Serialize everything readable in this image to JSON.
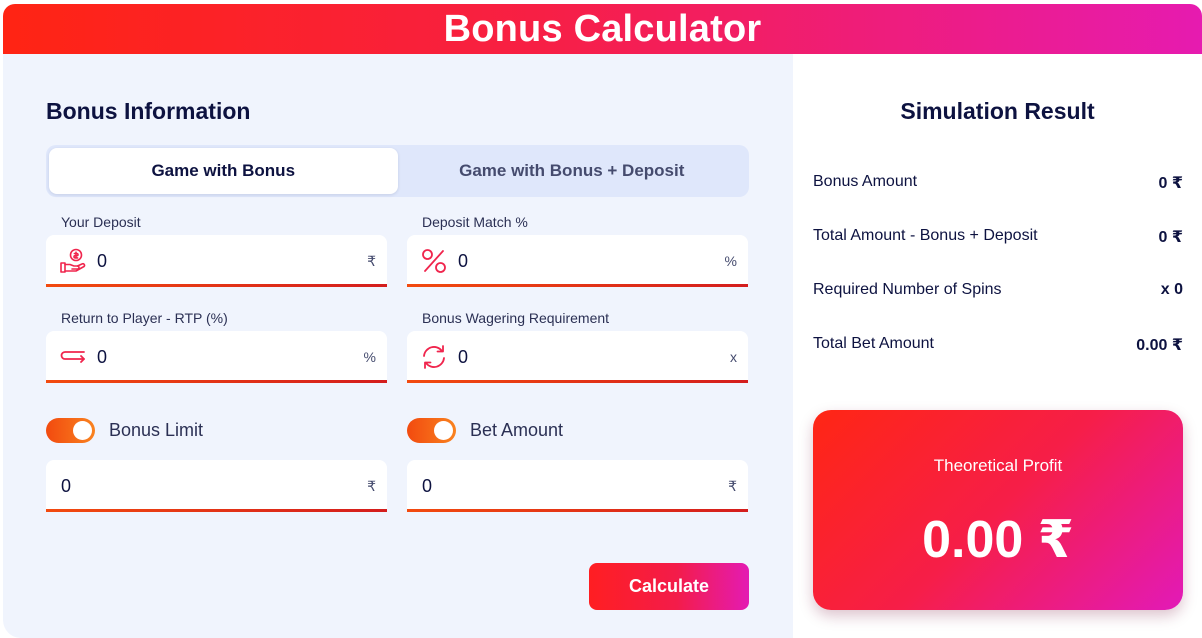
{
  "header": {
    "title": "Bonus Calculator"
  },
  "bonus_info": {
    "title": "Bonus Information",
    "tabs": [
      {
        "label": "Game with Bonus",
        "active": true
      },
      {
        "label": "Game with Bonus + Deposit",
        "active": false
      }
    ],
    "fields": {
      "deposit": {
        "label": "Your Deposit",
        "value": "0",
        "unit": "₹",
        "icon": "hand-coin-icon"
      },
      "deposit_match": {
        "label": "Deposit Match %",
        "value": "0",
        "unit": "%",
        "icon": "percent-icon"
      },
      "rtp": {
        "label": "Return to Player - RTP (%)",
        "value": "0",
        "unit": "%",
        "icon": "return-arrow-icon"
      },
      "wagering": {
        "label": "Bonus Wagering Requirement",
        "value": "0",
        "unit": "x",
        "icon": "refresh-icon"
      }
    },
    "toggles": {
      "bonus_limit": {
        "label": "Bonus Limit",
        "on": true,
        "value": "0",
        "unit": "₹"
      },
      "bet_amount": {
        "label": "Bet Amount",
        "on": true,
        "value": "0",
        "unit": "₹"
      }
    },
    "calculate_label": "Calculate"
  },
  "simulation": {
    "title": "Simulation Result",
    "rows": [
      {
        "label": "Bonus Amount",
        "value": "0 ₹"
      },
      {
        "label": "Total Amount - Bonus + Deposit",
        "value": "0 ₹"
      },
      {
        "label": "Required Number of Spins",
        "value": "x 0"
      },
      {
        "label": "Total Bet Amount",
        "value": "0.00 ₹"
      }
    ],
    "profit_label": "Theoretical Profit",
    "profit_value": "0.00 ₹"
  },
  "colors": {
    "accent_red": "#ff2413",
    "accent_magenta": "#e61bb0",
    "toggle_orange": "#f24a0f",
    "text_navy": "#0d1240",
    "panel_bg": "#f0f4fd"
  }
}
